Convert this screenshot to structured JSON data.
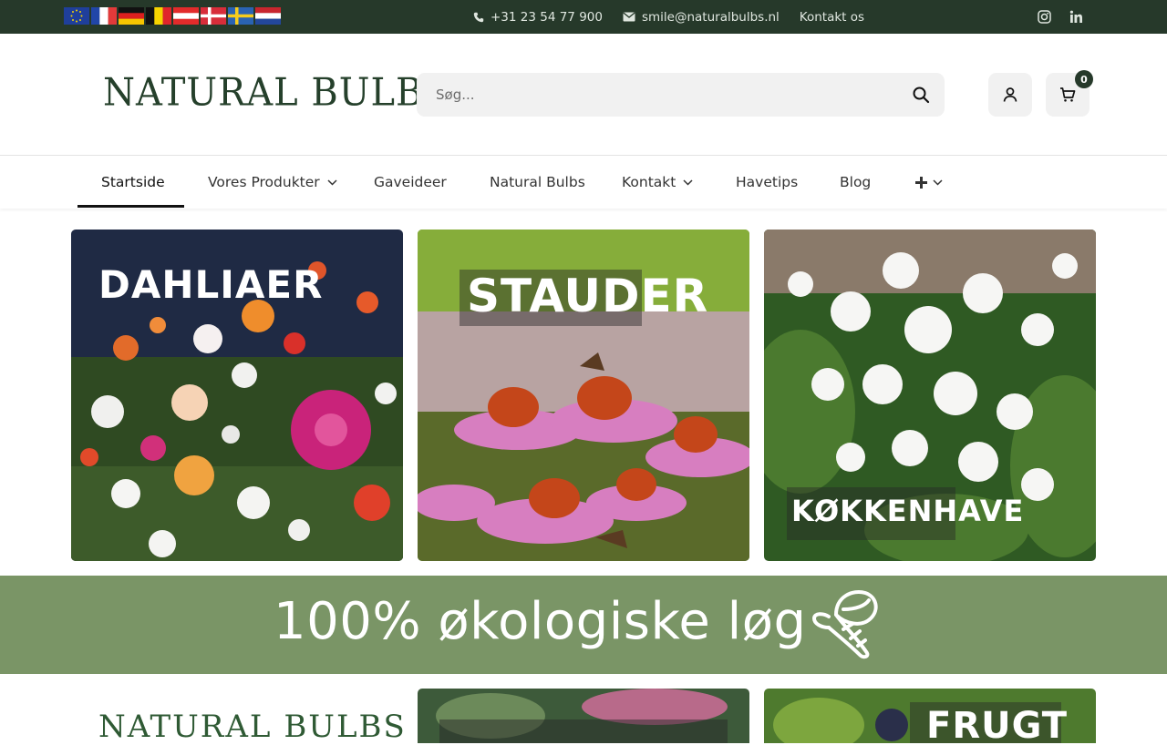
{
  "topbar": {
    "flags": [
      {
        "name": "eu-flag-icon"
      },
      {
        "name": "france-flag-icon"
      },
      {
        "name": "germany-flag-icon"
      },
      {
        "name": "belgium-flag-icon"
      },
      {
        "name": "austria-flag-icon"
      },
      {
        "name": "denmark-flag-icon"
      },
      {
        "name": "sweden-flag-icon"
      },
      {
        "name": "netherlands-flag-icon"
      }
    ],
    "phone": "+31 23 54 77 900",
    "email": "smile@naturalbulbs.nl",
    "contact_link": "Kontakt os",
    "social": [
      "instagram-icon",
      "linkedin-icon"
    ]
  },
  "header": {
    "logo_text": "NATURAL BULBS",
    "search_placeholder": "Søg...",
    "cart_count": "0"
  },
  "nav": {
    "items": [
      {
        "label": "Startside",
        "dropdown": false,
        "active": true
      },
      {
        "label": "Vores Produkter",
        "dropdown": true
      },
      {
        "label": "Gaveideer",
        "dropdown": false
      },
      {
        "label": "Natural Bulbs",
        "dropdown": false
      },
      {
        "label": "Kontakt",
        "dropdown": true
      },
      {
        "label": "Havetips",
        "dropdown": false
      },
      {
        "label": "Blog",
        "dropdown": false
      }
    ]
  },
  "categories": [
    {
      "label": "DAHLIAER"
    },
    {
      "label": "STAUDER"
    },
    {
      "label": "KØKKENHAVE"
    }
  ],
  "banner": {
    "text": "100% økologiske løg"
  },
  "bottom": {
    "logo_text": "NATURAL BULBS",
    "tile3_label": "FRUGT"
  },
  "colors": {
    "topbar_bg": "#26392a",
    "banner_bg": "#7a9566",
    "logo": "#25402b"
  }
}
